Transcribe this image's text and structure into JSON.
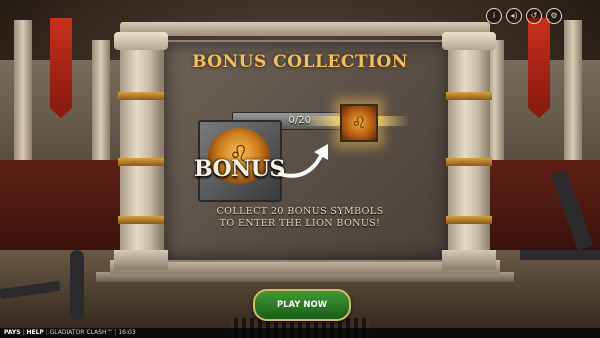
{
  "game": {
    "title": "BONUS COLLECTION",
    "progress": {
      "text": "0/20",
      "current": 0,
      "total": 20
    },
    "symbol_label": "BONUS",
    "description_line1": "COLLECT 20 BONUS SYMBOLS",
    "description_line2": "TO ENTER THE LION BONUS!",
    "play_button": "PLAY NOW",
    "colors": {
      "title_gold": "#f0c060",
      "play_green": "#3e9a34",
      "banner_red": "#c8301c"
    }
  },
  "top_icons": [
    {
      "name": "info-icon",
      "glyph": "i"
    },
    {
      "name": "sound-icon",
      "glyph": "◂)"
    },
    {
      "name": "history-icon",
      "glyph": "↺"
    },
    {
      "name": "settings-icon",
      "glyph": "⚙"
    }
  ],
  "footer": {
    "pays": "PAYS",
    "help": "HELP",
    "game_name": "GLADIATOR CLASH™",
    "time": "16:03"
  }
}
